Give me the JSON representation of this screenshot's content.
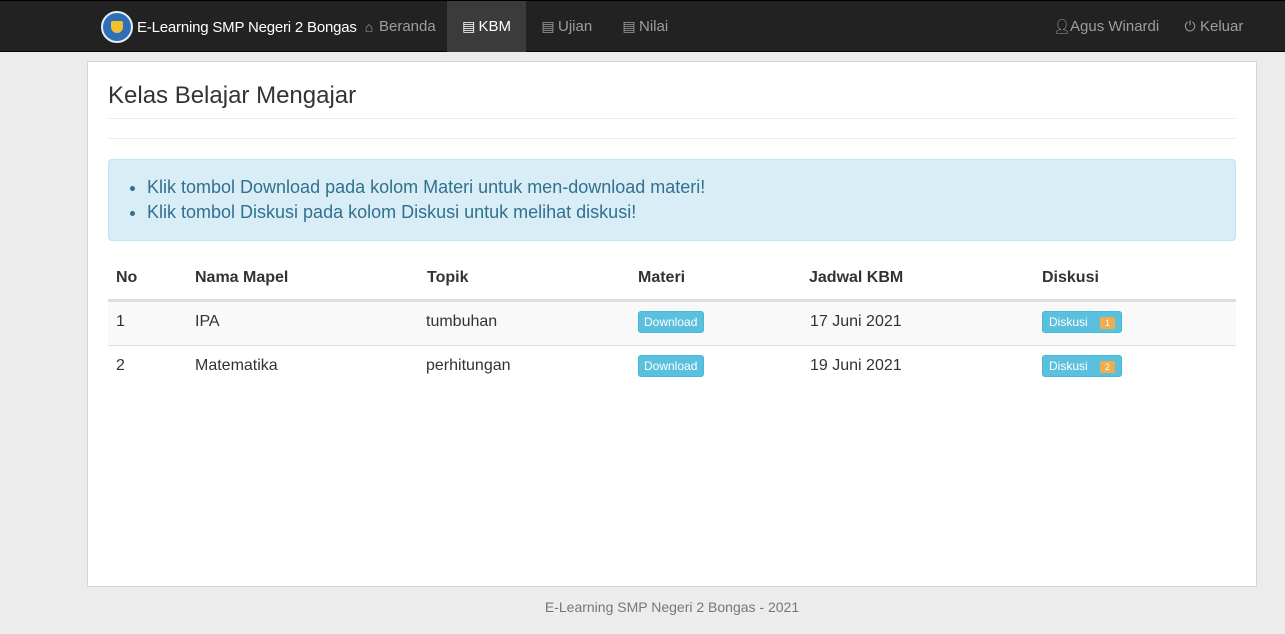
{
  "navbar": {
    "brand": "E-Learning SMP Negeri 2 Bongas",
    "items": [
      {
        "label": "Beranda",
        "icon": "home-icon"
      },
      {
        "label": "KBM",
        "icon": "list-icon",
        "active": true
      },
      {
        "label": "Ujian",
        "icon": "list-icon"
      },
      {
        "label": "Nilai",
        "icon": "list-icon"
      }
    ],
    "user": "Agus Winardi",
    "logout": "Keluar"
  },
  "page": {
    "title": "Kelas Belajar Mengajar",
    "alerts": [
      "Klik tombol Download pada kolom Materi untuk men-download materi!",
      "Klik tombol Diskusi pada kolom Diskusi untuk melihat diskusi!"
    ]
  },
  "table": {
    "headers": [
      "No",
      "Nama Mapel",
      "Topik",
      "Materi",
      "Jadwal KBM",
      "Diskusi"
    ],
    "rows": [
      {
        "no": "1",
        "mapel": "IPA",
        "topik": "tumbuhan",
        "materi": "Download",
        "jadwal": "17 Juni 2021",
        "diskusi": "Diskusi",
        "count": "1"
      },
      {
        "no": "2",
        "mapel": "Matematika",
        "topik": "perhitungan",
        "materi": "Download",
        "jadwal": "19 Juni 2021",
        "diskusi": "Diskusi",
        "count": "2"
      }
    ]
  },
  "footer": "E-Learning SMP Negeri 2 Bongas - 2021",
  "colors": {
    "navbar": "#222222",
    "alert_bg": "#d9edf7",
    "button": "#5bc0de",
    "badge": "#f0ad4e"
  }
}
